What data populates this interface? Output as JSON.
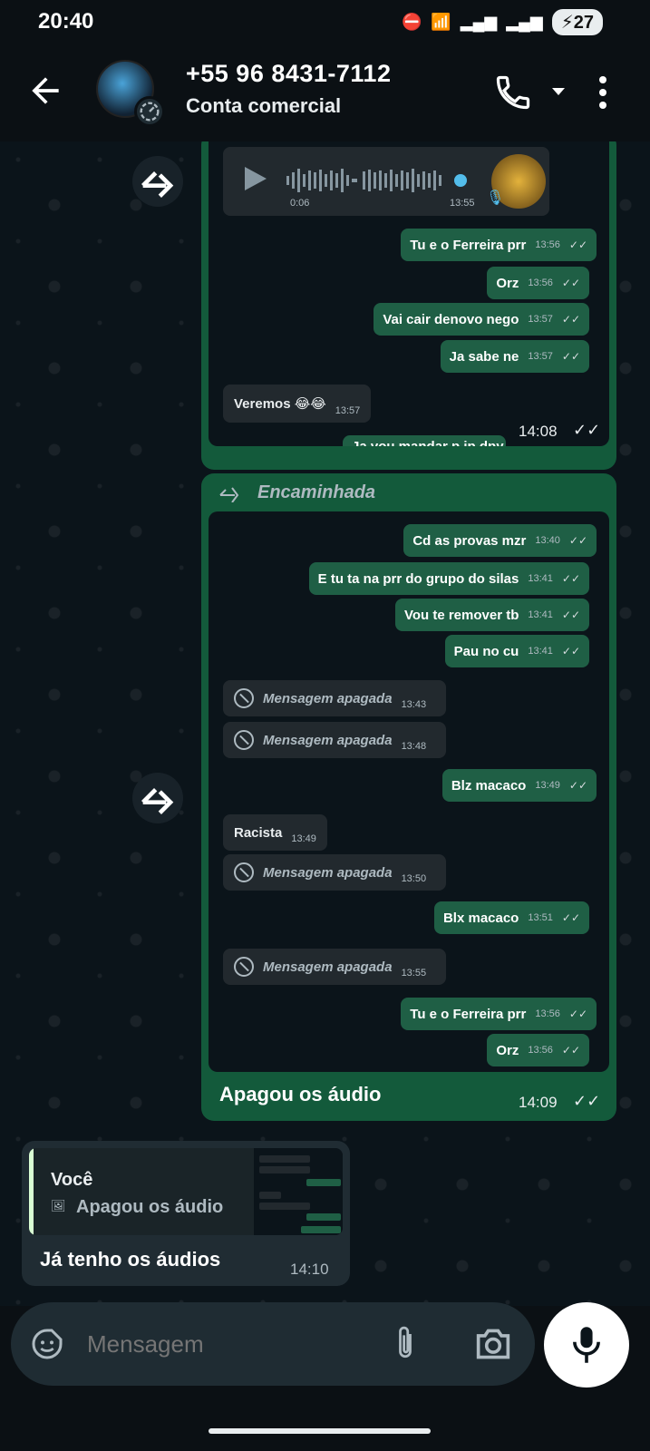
{
  "status": {
    "time": "20:40",
    "battery": "27"
  },
  "header": {
    "title": "+55 96 8431-7112",
    "subtitle": "Conta comercial"
  },
  "msg1": {
    "voice_duration": "0:06",
    "voice_time": "13:55",
    "rows": [
      {
        "text": "Tu e o Ferreira prr",
        "time": "13:56"
      },
      {
        "text": "Orz",
        "time": "13:56"
      },
      {
        "text": "Vai cair denovo nego",
        "time": "13:57"
      },
      {
        "text": "Ja sabe ne",
        "time": "13:57"
      },
      {
        "text": "Veremos 😂😂",
        "time": "13:57"
      },
      {
        "text": "Ja vou mandar p jp dpy ag"
      }
    ],
    "time": "14:08"
  },
  "msg2": {
    "forwarded_label": "Encaminhada",
    "rows": [
      {
        "text": "Cd as provas mzr",
        "time": "13:40"
      },
      {
        "text": "E tu ta na prr do grupo do silas",
        "time": "13:41"
      },
      {
        "text": "Vou te remover tb",
        "time": "13:41"
      },
      {
        "text": "Pau no cu",
        "time": "13:41"
      },
      {
        "text": "Mensagem apagada",
        "time": "13:43"
      },
      {
        "text": "Mensagem apagada",
        "time": "13:48"
      },
      {
        "text": "Blz macaco",
        "time": "13:49"
      },
      {
        "text": "Racista",
        "time": "13:49"
      },
      {
        "text": "Mensagem apagada",
        "time": "13:50"
      },
      {
        "text": "Blx macaco",
        "time": "13:51"
      },
      {
        "text": "Mensagem apagada",
        "time": "13:55"
      },
      {
        "text": "Tu e o Ferreira prr",
        "time": "13:56"
      },
      {
        "text": "Orz",
        "time": "13:56"
      }
    ],
    "caption": "Apagou os áudio",
    "time": "14:09"
  },
  "msg3": {
    "quote_author": "Você",
    "quote_text": "Apagou os áudio",
    "text": "Já tenho os áudios",
    "time": "14:10"
  },
  "composer": {
    "placeholder": "Mensagem"
  }
}
